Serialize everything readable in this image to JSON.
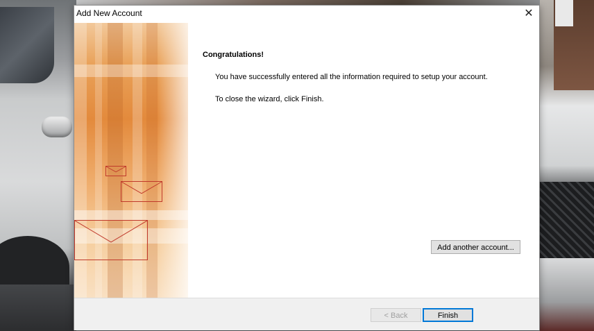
{
  "dialog": {
    "title": "Add New Account",
    "close_icon": "close-icon"
  },
  "content": {
    "heading": "Congratulations!",
    "message_success": "You have successfully entered all the information required to setup your account.",
    "message_close": "To close the wizard, click Finish.",
    "add_another_label": "Add another account..."
  },
  "footer": {
    "back_label": "< Back",
    "finish_label": "Finish",
    "back_enabled": false
  },
  "colors": {
    "accent": "#0078d7",
    "art_orange": "#e38a3c",
    "envelope_outline": "#c0392b",
    "footer_bg": "#f0f0f0"
  },
  "icons": [
    "close-icon",
    "envelope-icon"
  ]
}
